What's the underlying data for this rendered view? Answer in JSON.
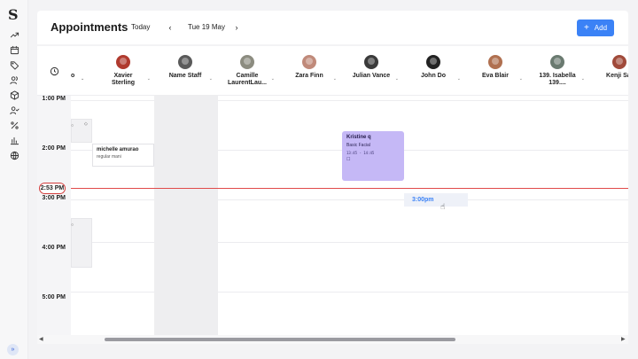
{
  "app": {
    "logo": "S"
  },
  "header": {
    "title": "Appointments",
    "today_label": "Today",
    "prev_label": "‹",
    "next_label": "›",
    "date_label": "Tue 19 May",
    "add_label": "Add",
    "add_icon": "+"
  },
  "sidebar": {
    "icons": [
      "trend-icon",
      "calendar-icon",
      "tag-icon",
      "users-icon",
      "box-icon",
      "user-check-icon",
      "percent-icon",
      "chart-icon",
      "globe-icon"
    ],
    "expand_label": "»"
  },
  "staff": {
    "truncated_label": "o",
    "columns": [
      {
        "name": "Xavier\nSterling",
        "color": "#b03a2e"
      },
      {
        "name": "Name Staff",
        "color": "#5a5a5a"
      },
      {
        "name": "Camille\nLaurentLau...",
        "color": "#8c8c80"
      },
      {
        "name": "Zara Finn",
        "color": "#c08a7a"
      },
      {
        "name": "Julian Vance",
        "color": "#3a3a3a"
      },
      {
        "name": "John Do",
        "color": "#222222"
      },
      {
        "name": "Eva Blair",
        "color": "#b07050"
      },
      {
        "name": "139. Isabella\n139....",
        "color": "#6a7a70"
      },
      {
        "name": "Kenji Sat",
        "color": "#a04a3a"
      }
    ],
    "caret": "⌄"
  },
  "times": [
    "1:00 PM",
    "2:00 PM",
    "3:00 PM",
    "4:00 PM",
    "5:00 PM"
  ],
  "now": {
    "label": "2:53 PM"
  },
  "appointments": {
    "white": {
      "name": "michelle amurao",
      "service": "regular mani"
    },
    "purple": {
      "name": "Kristine q",
      "service": "Basic Facial",
      "time": "13:45 - 14:45",
      "icon": "☐"
    }
  },
  "hover_slot": {
    "label": "3:00pm"
  },
  "scroll": {
    "left": "◀",
    "right": "▶"
  }
}
